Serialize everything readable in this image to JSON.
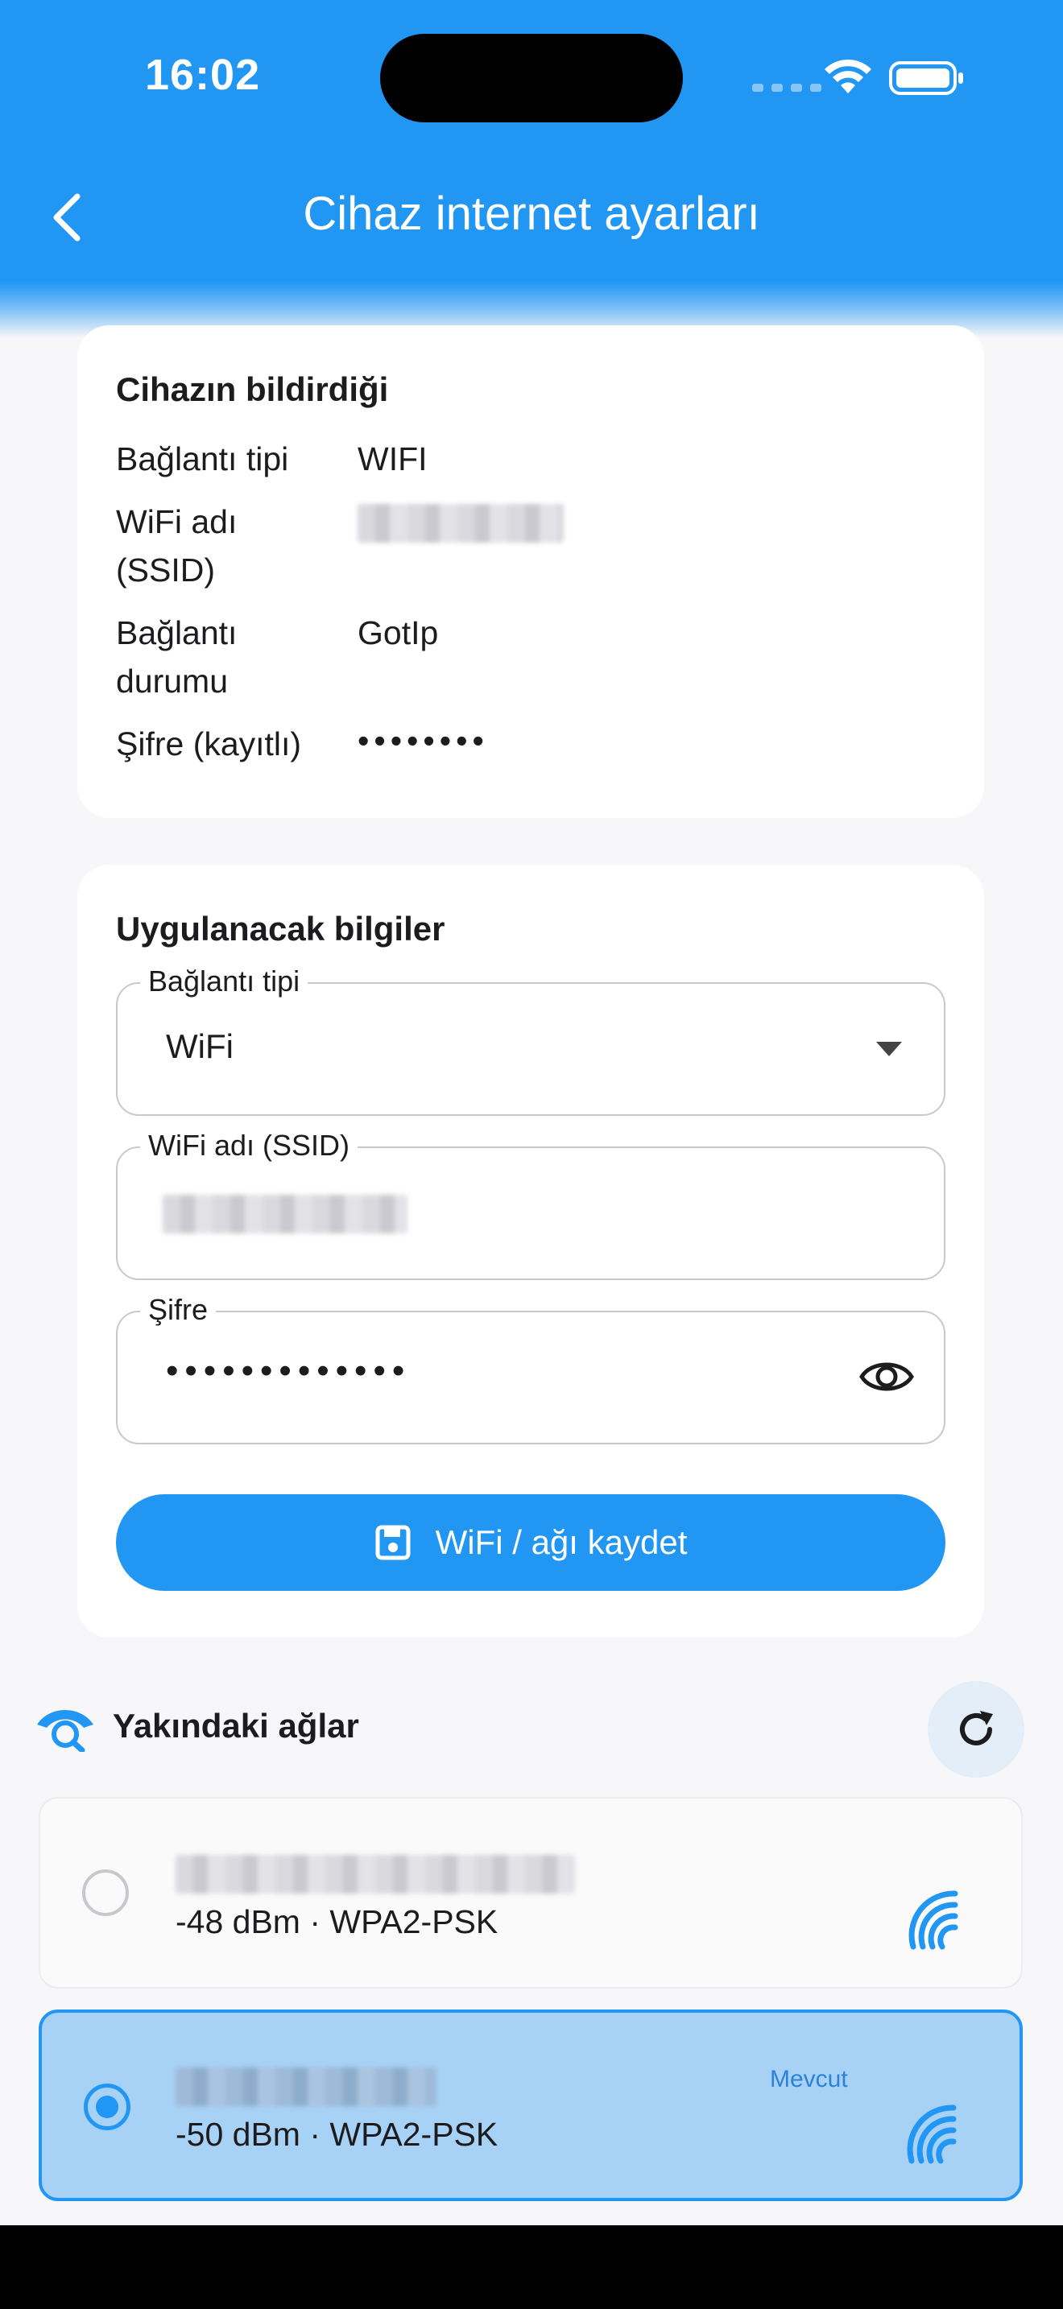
{
  "status_bar": {
    "time": "16:02"
  },
  "nav": {
    "title": "Cihaz internet ayarları"
  },
  "device_report": {
    "title": "Cihazın bildirdiği",
    "rows": [
      {
        "label": "Bağlantı tipi",
        "value": "WIFI"
      },
      {
        "label": "WiFi adı (SSID)",
        "value": ""
      },
      {
        "label": "Bağlantı durumu",
        "value": "GotIp"
      },
      {
        "label": "Şifre (kayıtlı)",
        "value": "••••••••"
      }
    ]
  },
  "apply_form": {
    "title": "Uygulanacak bilgiler",
    "connection_type": {
      "label": "Bağlantı tipi",
      "value": "WiFi"
    },
    "ssid": {
      "label": "WiFi adı (SSID)",
      "value": ""
    },
    "password": {
      "label": "Şifre",
      "value": "•••••••••••••"
    },
    "save_label": "WiFi / ağı kaydet"
  },
  "nearby": {
    "title": "Yakındaki ağlar",
    "networks": [
      {
        "ssid": "",
        "meta": "-48 dBm · WPA2-PSK",
        "selected": false,
        "badge": ""
      },
      {
        "ssid": "",
        "meta": "-50 dBm · WPA2-PSK",
        "selected": true,
        "badge": "Mevcut"
      }
    ]
  },
  "colors": {
    "primary": "#2196f3",
    "selected_bg": "#a8d1f6",
    "card": "#ffffff",
    "background": "#f7f7f9"
  },
  "icons": [
    "back-chevron-icon",
    "chevron-down-icon",
    "eye-icon",
    "save-icon",
    "wifi-eye-icon",
    "refresh-icon",
    "wifi-signal-icon"
  ]
}
